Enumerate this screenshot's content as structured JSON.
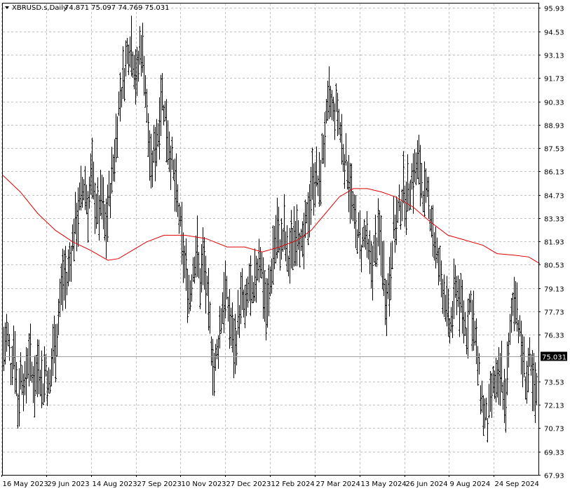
{
  "header": {
    "symbol_label": "XBRUSD.s,Daily",
    "ohlc_label": "74.871 75.097 74.769 75.031"
  },
  "colors": {
    "background": "#ffffff",
    "grid": "#c0c0c0",
    "bars": "#000000",
    "moving_average": "#e00000",
    "last_price_badge": "#000000"
  },
  "chart_data": {
    "type": "line",
    "subtype": "ohlc-bars",
    "title": "XBRUSD.s,Daily",
    "ylim": [
      67.93,
      96.2
    ],
    "grid": true,
    "yticks": [
      95.93,
      94.53,
      93.13,
      91.73,
      90.33,
      88.93,
      87.53,
      86.13,
      84.73,
      83.33,
      81.93,
      80.53,
      79.13,
      77.73,
      76.33,
      73.53,
      72.13,
      70.73,
      69.33,
      67.93
    ],
    "last_price": 75.031,
    "last_price_label": "75.031",
    "xticks": [
      "16 May 2023",
      "29 Jun 2023",
      "14 Aug 2023",
      "27 Sep 2023",
      "10 Nov 2023",
      "27 Dec 2023",
      "12 Feb 2024",
      "27 Mar 2024",
      "13 May 2024",
      "26 Jun 2024",
      "9 Aug 2024",
      "24 Sep 2024"
    ],
    "price_path_bars": [
      [
        0,
        75.5
      ],
      [
        5,
        76.5
      ],
      [
        10,
        74.5
      ],
      [
        15,
        76.0
      ],
      [
        20,
        72.0
      ],
      [
        25,
        74.5
      ],
      [
        30,
        73.0
      ],
      [
        35,
        75.5
      ],
      [
        40,
        74.0
      ],
      [
        45,
        73.5
      ],
      [
        50,
        75.0
      ],
      [
        55,
        73.0
      ],
      [
        60,
        74.5
      ],
      [
        65,
        72.8
      ],
      [
        70,
        75.5
      ],
      [
        75,
        76.0
      ],
      [
        80,
        78.5
      ],
      [
        85,
        80.0
      ],
      [
        90,
        79.5
      ],
      [
        95,
        81.0
      ],
      [
        100,
        82.5
      ],
      [
        105,
        83.5
      ],
      [
        110,
        84.5
      ],
      [
        115,
        85.5
      ],
      [
        120,
        84.0
      ],
      [
        125,
        86.0
      ],
      [
        130,
        84.5
      ],
      [
        135,
        83.5
      ],
      [
        140,
        84.5
      ],
      [
        145,
        82.5
      ],
      [
        150,
        84.5
      ],
      [
        155,
        86.0
      ],
      [
        160,
        88.0
      ],
      [
        165,
        90.5
      ],
      [
        170,
        91.5
      ],
      [
        175,
        93.0
      ],
      [
        180,
        94.0
      ],
      [
        185,
        93.0
      ],
      [
        190,
        91.5
      ],
      [
        195,
        94.0
      ],
      [
        200,
        92.5
      ],
      [
        205,
        89.0
      ],
      [
        210,
        86.0
      ],
      [
        215,
        87.5
      ],
      [
        220,
        88.5
      ],
      [
        225,
        91.0
      ],
      [
        230,
        89.5
      ],
      [
        235,
        88.0
      ],
      [
        240,
        86.5
      ],
      [
        245,
        85.0
      ],
      [
        250,
        83.5
      ],
      [
        255,
        81.5
      ],
      [
        260,
        80.0
      ],
      [
        265,
        78.5
      ],
      [
        270,
        80.5
      ],
      [
        275,
        81.5
      ],
      [
        280,
        79.5
      ],
      [
        285,
        81.0
      ],
      [
        290,
        78.5
      ],
      [
        295,
        76.5
      ],
      [
        300,
        74.0
      ],
      [
        305,
        75.5
      ],
      [
        310,
        77.5
      ],
      [
        315,
        79.0
      ],
      [
        320,
        78.0
      ],
      [
        325,
        76.5
      ],
      [
        330,
        75.5
      ],
      [
        335,
        77.5
      ],
      [
        340,
        78.5
      ],
      [
        345,
        77.5
      ],
      [
        350,
        79.5
      ],
      [
        355,
        78.0
      ],
      [
        360,
        80.0
      ],
      [
        365,
        81.5
      ],
      [
        370,
        79.5
      ],
      [
        375,
        77.5
      ],
      [
        380,
        79.5
      ],
      [
        385,
        81.5
      ],
      [
        390,
        82.5
      ],
      [
        395,
        81.5
      ],
      [
        400,
        82.5
      ],
      [
        405,
        80.5
      ],
      [
        410,
        81.5
      ],
      [
        415,
        82.5
      ],
      [
        420,
        83.0
      ],
      [
        425,
        81.0
      ],
      [
        430,
        82.5
      ],
      [
        435,
        84.0
      ],
      [
        440,
        85.5
      ],
      [
        445,
        86.0
      ],
      [
        450,
        85.0
      ],
      [
        455,
        87.5
      ],
      [
        460,
        89.0
      ],
      [
        465,
        90.5
      ],
      [
        470,
        89.5
      ],
      [
        475,
        90.0
      ],
      [
        480,
        88.5
      ],
      [
        485,
        87.0
      ],
      [
        490,
        86.5
      ],
      [
        495,
        85.0
      ],
      [
        500,
        83.0
      ],
      [
        505,
        82.5
      ],
      [
        510,
        81.5
      ],
      [
        515,
        82.5
      ],
      [
        520,
        81.0
      ],
      [
        525,
        80.5
      ],
      [
        530,
        81.5
      ],
      [
        535,
        82.5
      ],
      [
        540,
        81.0
      ],
      [
        545,
        78.5
      ],
      [
        550,
        79.5
      ],
      [
        555,
        82.5
      ],
      [
        560,
        83.0
      ],
      [
        565,
        84.0
      ],
      [
        570,
        85.0
      ],
      [
        575,
        84.5
      ],
      [
        580,
        85.5
      ],
      [
        585,
        86.0
      ],
      [
        590,
        86.5
      ],
      [
        595,
        86.0
      ],
      [
        600,
        84.5
      ],
      [
        605,
        84.5
      ],
      [
        610,
        83.5
      ],
      [
        615,
        81.5
      ],
      [
        620,
        80.5
      ],
      [
        625,
        79.5
      ],
      [
        630,
        78.5
      ],
      [
        635,
        76.5
      ],
      [
        640,
        77.5
      ],
      [
        645,
        79.5
      ],
      [
        650,
        78.5
      ],
      [
        655,
        77.5
      ],
      [
        660,
        76.5
      ],
      [
        665,
        78.5
      ],
      [
        670,
        77.0
      ],
      [
        675,
        75.0
      ],
      [
        680,
        73.0
      ],
      [
        685,
        71.5
      ],
      [
        690,
        71.0
      ],
      [
        695,
        72.5
      ],
      [
        700,
        73.5
      ],
      [
        705,
        73.0
      ],
      [
        710,
        74.0
      ],
      [
        715,
        72.0
      ],
      [
        720,
        75.0
      ],
      [
        725,
        78.0
      ],
      [
        730,
        79.0
      ],
      [
        735,
        76.5
      ],
      [
        740,
        75.0
      ],
      [
        745,
        73.5
      ],
      [
        750,
        74.5
      ],
      [
        755,
        73.0
      ],
      [
        760,
        72.5
      ],
      [
        765,
        75.0
      ]
    ],
    "moving_average": [
      [
        0,
        85.9
      ],
      [
        25,
        84.9
      ],
      [
        50,
        83.6
      ],
      [
        75,
        82.6
      ],
      [
        100,
        81.9
      ],
      [
        125,
        81.4
      ],
      [
        150,
        80.8
      ],
      [
        165,
        80.9
      ],
      [
        185,
        81.4
      ],
      [
        205,
        81.9
      ],
      [
        230,
        82.3
      ],
      [
        260,
        82.3
      ],
      [
        290,
        82.1
      ],
      [
        320,
        81.6
      ],
      [
        345,
        81.6
      ],
      [
        370,
        81.3
      ],
      [
        395,
        81.6
      ],
      [
        420,
        82.0
      ],
      [
        440,
        82.6
      ],
      [
        460,
        83.6
      ],
      [
        480,
        84.6
      ],
      [
        500,
        85.1
      ],
      [
        520,
        85.1
      ],
      [
        540,
        84.9
      ],
      [
        560,
        84.6
      ],
      [
        585,
        84.0
      ],
      [
        610,
        83.1
      ],
      [
        635,
        82.3
      ],
      [
        660,
        82.0
      ],
      [
        685,
        81.7
      ],
      [
        705,
        81.2
      ],
      [
        730,
        81.1
      ],
      [
        750,
        81.0
      ],
      [
        766,
        80.6
      ]
    ]
  }
}
